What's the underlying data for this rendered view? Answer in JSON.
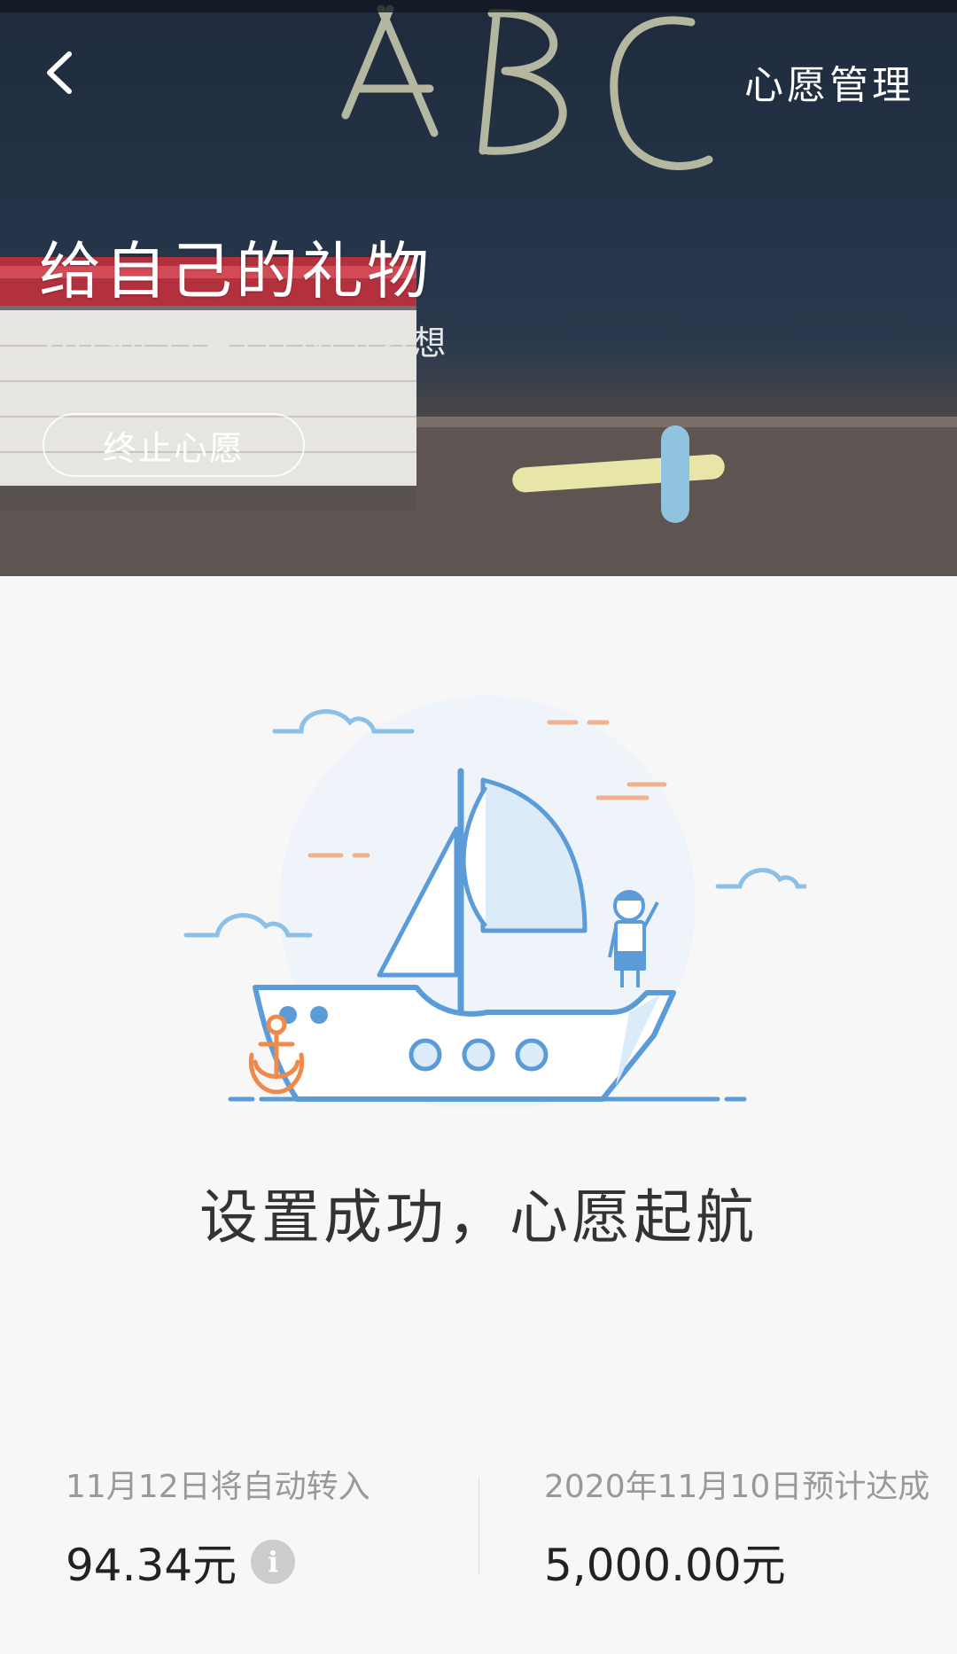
{
  "header": {
    "back_icon": "chevron-left-icon",
    "manage_label": "心愿管理"
  },
  "wish": {
    "title": "给自己的礼物",
    "created": "2019年11月11日建立梦想",
    "stop_label": "终止心愿"
  },
  "illustration": {
    "icon": "sailboat-illustration",
    "colors": {
      "line": "#5b9bd8",
      "fill": "#dcebf8",
      "accent": "#f08a4b"
    }
  },
  "status": {
    "message": "设置成功，心愿起航"
  },
  "stats": {
    "auto_transfer": {
      "label": "11月12日将自动转入",
      "value": "94.34元",
      "info_icon": "info-icon"
    },
    "target": {
      "label": "2020年11月10日预计达成",
      "value": "5,000.00元"
    }
  }
}
